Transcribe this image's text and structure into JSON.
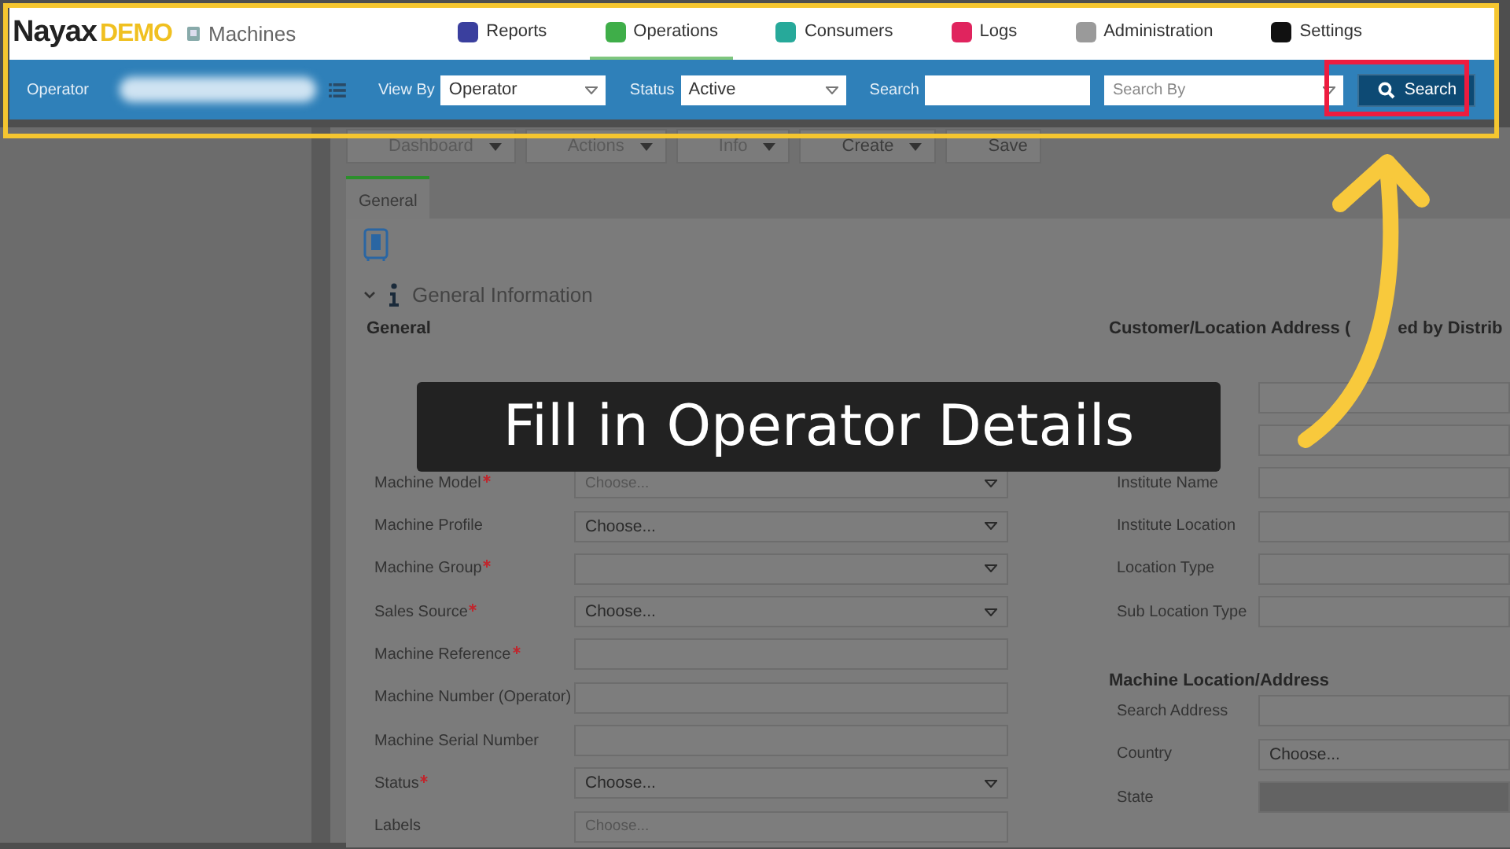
{
  "header": {
    "brand": "Nayax",
    "brand_suffix": "DEMO",
    "section": "Machines",
    "nav": [
      {
        "label": "Reports",
        "color": "#3a3f9e",
        "selected": false
      },
      {
        "label": "Operations",
        "color": "#3fae49",
        "selected": true
      },
      {
        "label": "Consumers",
        "color": "#27a99a",
        "selected": false
      },
      {
        "label": "Logs",
        "color": "#e0245e",
        "selected": false
      },
      {
        "label": "Administration",
        "color": "#9a9a9a",
        "selected": false
      },
      {
        "label": "Settings",
        "color": "#111111",
        "selected": false
      }
    ]
  },
  "filter_bar": {
    "operator_label": "Operator",
    "view_by_label": "View By",
    "view_by_value": "Operator",
    "status_label": "Status",
    "status_value": "Active",
    "search_label": "Search",
    "search_by_placeholder": "Search By",
    "search_button": "Search"
  },
  "toolbar": [
    {
      "label": "Dashboard",
      "kind": "dropdown",
      "disabled": true
    },
    {
      "label": "Actions",
      "kind": "dropdown",
      "disabled": true
    },
    {
      "label": "Info",
      "kind": "dropdown",
      "disabled": true
    },
    {
      "label": "Create",
      "kind": "dropdown",
      "disabled": false
    },
    {
      "label": "Save",
      "kind": "button",
      "disabled": false
    }
  ],
  "tabs": [
    {
      "label": "General",
      "selected": true
    }
  ],
  "section_title": "General Information",
  "left": {
    "heading": "General",
    "rows": [
      {
        "label": "Machine Model",
        "required": true,
        "kind": "select",
        "placeholder": "Choose..."
      },
      {
        "label": "Machine Profile",
        "required": false,
        "kind": "select",
        "value": "Choose..."
      },
      {
        "label": "Machine Group",
        "required": true,
        "kind": "select"
      },
      {
        "label": "Sales Source",
        "required": true,
        "kind": "select",
        "value": "Choose..."
      },
      {
        "label": "Machine Reference",
        "required": true,
        "kind": "text"
      },
      {
        "label": "Machine Number (Operator)",
        "required": false,
        "kind": "text"
      },
      {
        "label": "Machine Serial Number",
        "required": false,
        "kind": "text"
      },
      {
        "label": "Status",
        "required": true,
        "kind": "select",
        "value": "Choose..."
      },
      {
        "label": "Labels",
        "required": false,
        "kind": "text",
        "placeholder": "Choose..."
      }
    ]
  },
  "right": {
    "heading": "Customer/Location Address (",
    "heading_tail": "ed by Distrib",
    "rows": [
      {
        "disabled": false
      },
      {
        "disabled": false
      },
      {
        "label": "Institute Name",
        "disabled": false
      },
      {
        "label": "Institute Location",
        "disabled": false
      },
      {
        "label": "Location Type",
        "disabled": false
      },
      {
        "label": "Sub Location Type",
        "disabled": false
      }
    ],
    "heading2": "Machine Location/Address",
    "rows2": [
      {
        "label": "Search Address",
        "disabled": false
      },
      {
        "label": "Country",
        "value": "Choose...",
        "disabled": false
      },
      {
        "label": "State",
        "disabled": true
      }
    ]
  },
  "caption": "Fill in Operator Details"
}
